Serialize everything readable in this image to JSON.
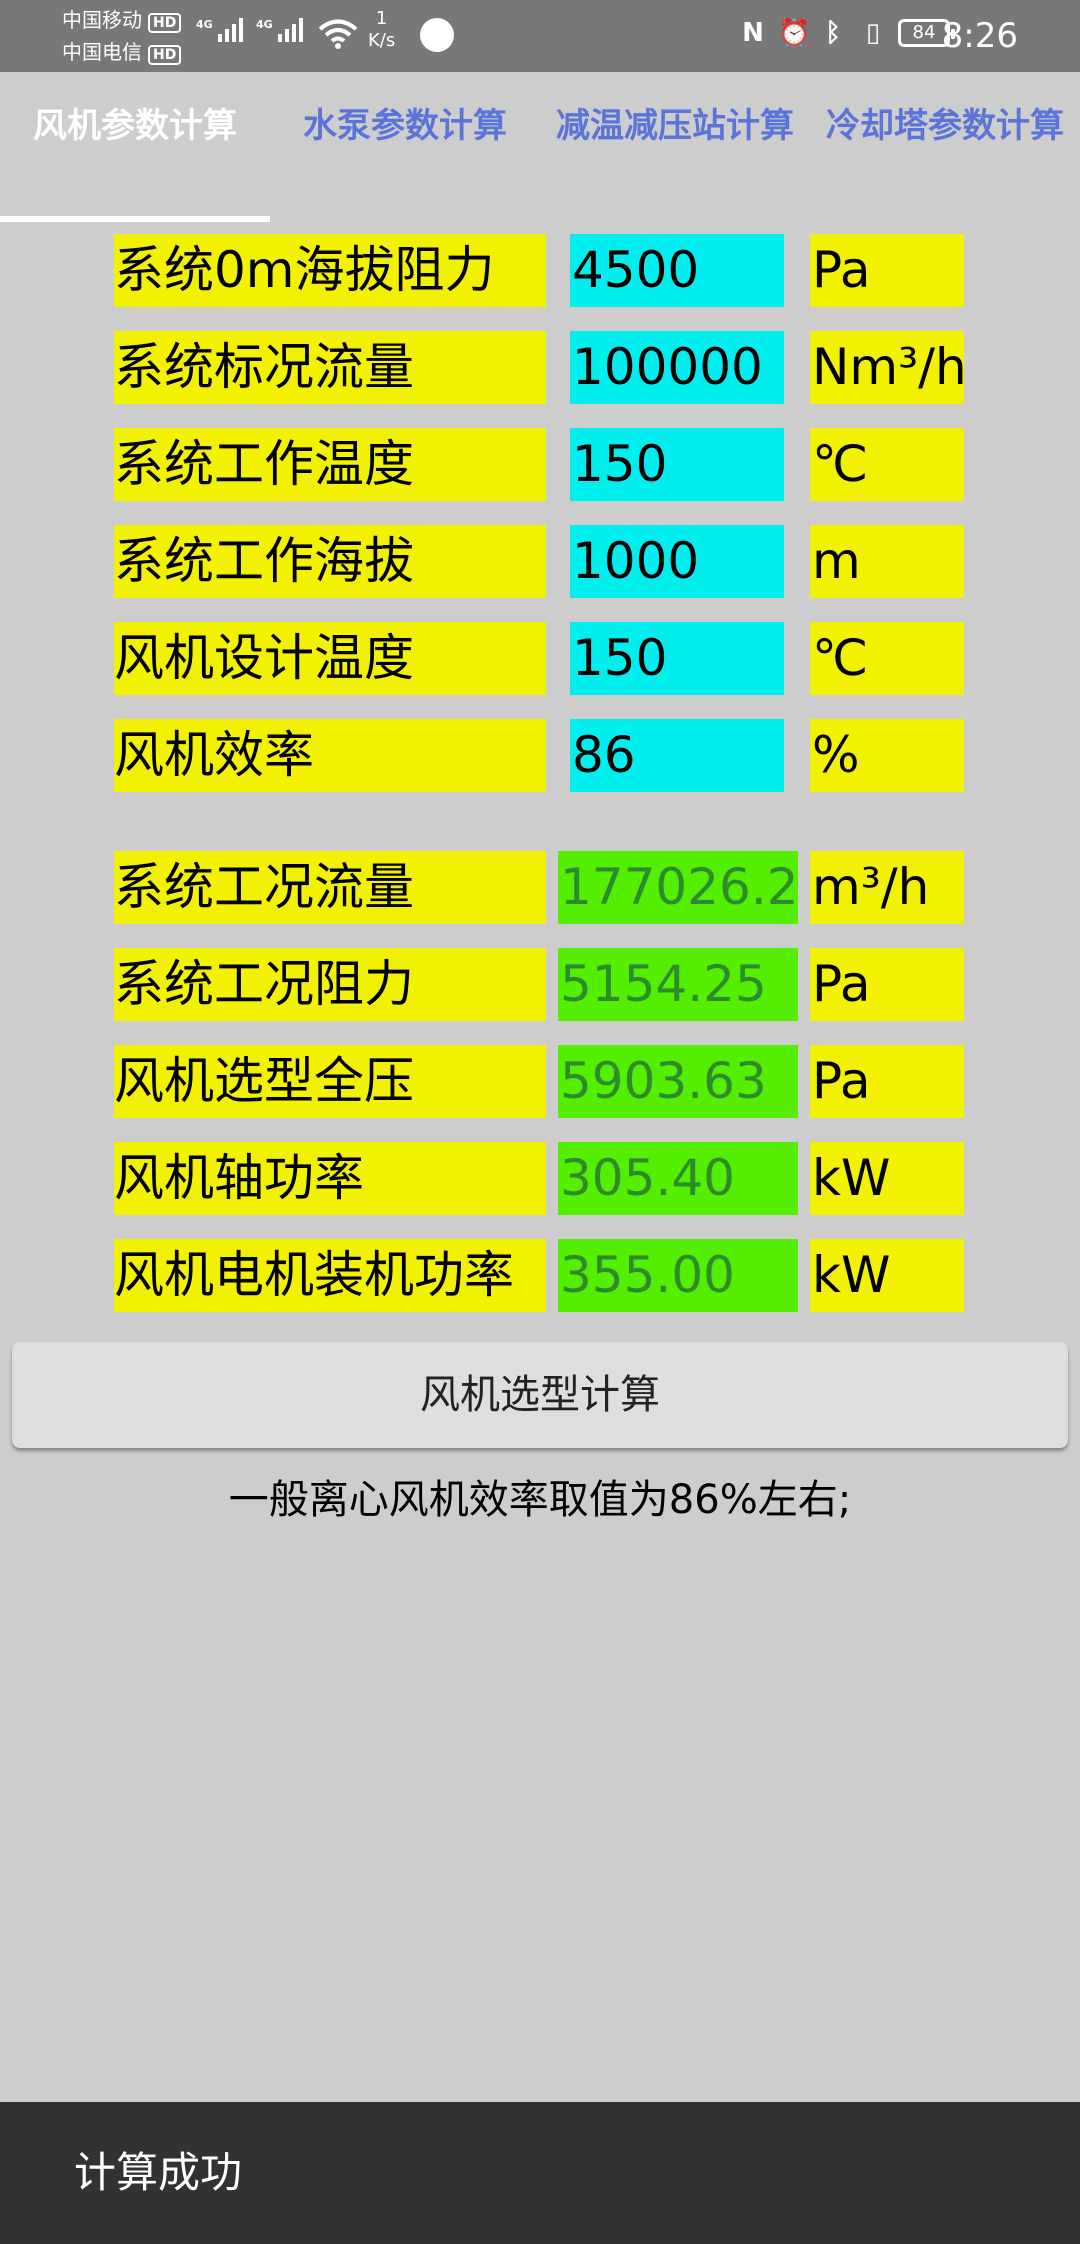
{
  "status_bar": {
    "carrier1": "中国移动",
    "carrier2": "中国电信",
    "hd_badge": "HD",
    "network_label": "4G",
    "speed_value": "1",
    "speed_unit": "K/s",
    "battery": "84",
    "time": "8:26",
    "icons": [
      "nfc-icon",
      "alarm-icon",
      "bluetooth-icon",
      "vibrate-icon"
    ]
  },
  "tabs": [
    {
      "label": "风机参数计算",
      "active": true
    },
    {
      "label": "水泵参数计算",
      "active": false
    },
    {
      "label": "减温减压站计算",
      "active": false
    },
    {
      "label": "冷却塔参数计算",
      "active": false
    }
  ],
  "inputs": [
    {
      "label": "系统0m海拔阻力",
      "value": "4500",
      "unit": "Pa"
    },
    {
      "label": "系统标况流量",
      "value": "100000",
      "unit": "Nm³/h"
    },
    {
      "label": "系统工作温度",
      "value": "150",
      "unit": "℃"
    },
    {
      "label": "系统工作海拔",
      "value": "1000",
      "unit": "m"
    },
    {
      "label": "风机设计温度",
      "value": "150",
      "unit": "℃"
    },
    {
      "label": "风机效率",
      "value": "86",
      "unit": "%"
    }
  ],
  "outputs": [
    {
      "label": "系统工况流量",
      "value": "177026.2",
      "unit": "m³/h"
    },
    {
      "label": "系统工况阻力",
      "value": "5154.25",
      "unit": "Pa"
    },
    {
      "label": "风机选型全压",
      "value": "5903.63",
      "unit": "Pa"
    },
    {
      "label": "风机轴功率",
      "value": "305.40",
      "unit": "kW"
    },
    {
      "label": "风机电机装机功率",
      "value": "355.00",
      "unit": "kW"
    }
  ],
  "calc_button": "风机选型计算",
  "tip": "一般离心风机效率取值为86%左右;",
  "snackbar": "计算成功",
  "colors": {
    "label_bg": "#f2f200",
    "input_bg": "#00eeee",
    "output_bg": "#55ee00",
    "output_text": "#2c8c2c",
    "tab_inactive": "#5b74d8"
  }
}
